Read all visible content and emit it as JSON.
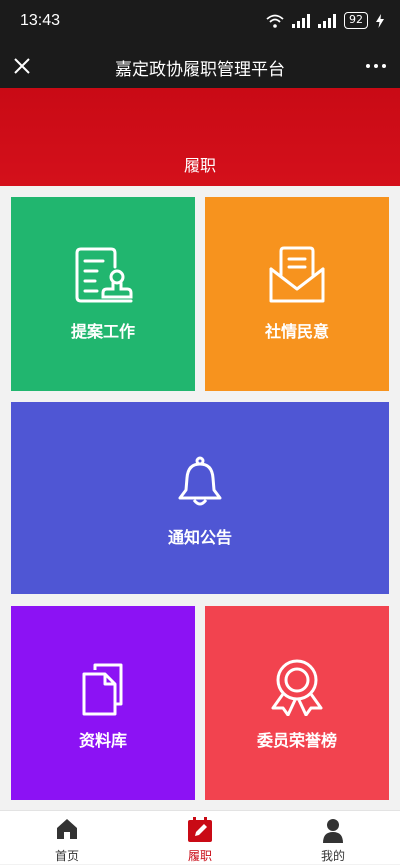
{
  "status": {
    "time": "13:43",
    "battery": "92"
  },
  "header": {
    "title": "嘉定政协履职管理平台"
  },
  "banner": {
    "label": "履职"
  },
  "tiles": [
    {
      "label": "提案工作",
      "icon": "proposal-document-icon",
      "color": "#21b66f"
    },
    {
      "label": "社情民意",
      "icon": "open-envelope-icon",
      "color": "#f7931e"
    },
    {
      "label": "通知公告",
      "icon": "bell-icon",
      "color": "#4f56d4"
    },
    {
      "label": "资料库",
      "icon": "documents-icon",
      "color": "#8c12f4"
    },
    {
      "label": "委员荣誉榜",
      "icon": "award-ribbon-icon",
      "color": "#f2434f"
    }
  ],
  "tabbar": {
    "items": [
      {
        "label": "首页",
        "icon": "home-icon"
      },
      {
        "label": "履职",
        "icon": "clipboard-pen-icon",
        "active": true
      },
      {
        "label": "我的",
        "icon": "user-icon"
      }
    ]
  },
  "colors": {
    "accent": "#c90a15",
    "header_bg": "#1b1b1b"
  }
}
